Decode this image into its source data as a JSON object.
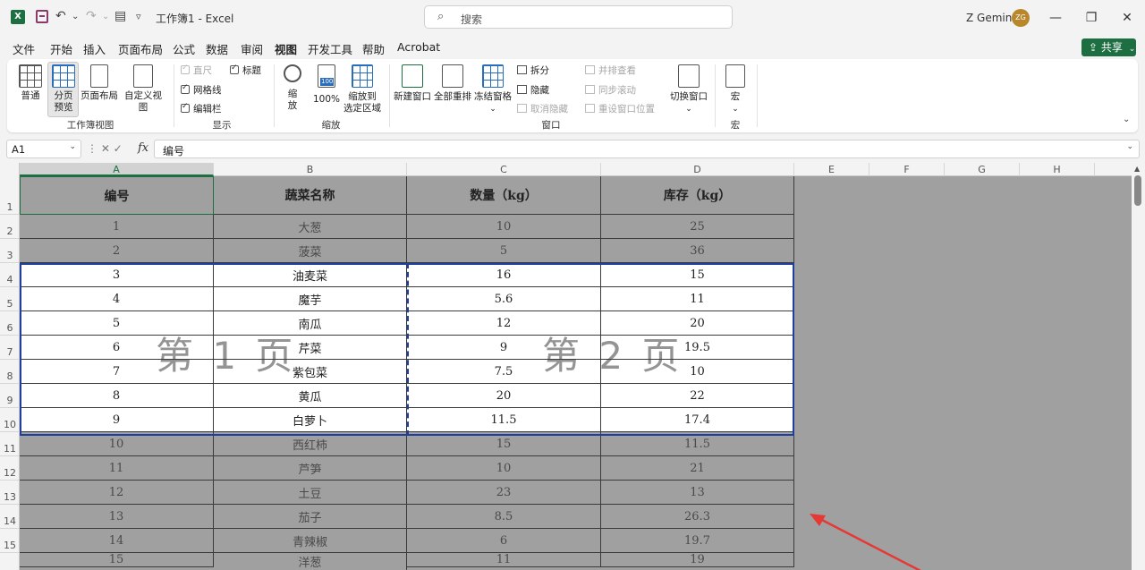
{
  "titlebar": {
    "logo": "X",
    "undo": "↶",
    "redo": "↷",
    "dropdown": "⌄",
    "form_icon": "▤",
    "customize": "▿",
    "title": "工作簿1 - Excel",
    "search_placeholder": "搜索",
    "search_icon": "⌕",
    "user_name": "Z Gemini",
    "avatar_initials": "ZG",
    "minimize": "—",
    "restore": "❐",
    "close": "✕"
  },
  "menu": {
    "items": [
      "文件",
      "开始",
      "插入",
      "页面布局",
      "公式",
      "数据",
      "审阅",
      "视图",
      "开发工具",
      "帮助",
      "Acrobat"
    ],
    "active": "视图",
    "share": "共享",
    "share_icon": "⇪"
  },
  "ribbon": {
    "workbook_views": {
      "label": "工作簿视图",
      "normal": "普通",
      "page_break_1": "分页",
      "page_break_2": "预览",
      "page_layout": "页面布局",
      "custom_views": "自定义视图"
    },
    "show": {
      "label": "显示",
      "ruler": "直尺",
      "gridlines": "网格线",
      "formula_bar": "编辑栏",
      "headings": "标题"
    },
    "zoom": {
      "label": "缩放",
      "zoom_1": "缩",
      "zoom_2": "放",
      "percent_100": "100%",
      "to_selection_1": "缩放到",
      "to_selection_2": "选定区域",
      "icon_100": "100"
    },
    "window": {
      "label": "窗口",
      "new_window": "新建窗口",
      "arrange_all": "全部重排",
      "freeze_panes": "冻结窗格",
      "split": "拆分",
      "hide": "隐藏",
      "unhide": "取消隐藏",
      "side_by_side": "并排查看",
      "sync_scroll": "同步滚动",
      "reset_position": "重设窗口位置",
      "switch_windows": "切换窗口",
      "caret": "⌄"
    },
    "macros": {
      "label": "宏",
      "macros": "宏",
      "caret": "⌄"
    },
    "collapse": "⌄"
  },
  "formula_bar": {
    "name_box": "A1",
    "name_dd": "⌄",
    "cancel_enter": "⋮  ✕  ✓",
    "fx": "fx",
    "content": "编号",
    "expand": "⌄"
  },
  "grid": {
    "columns": [
      "A",
      "B",
      "C",
      "D",
      "E",
      "F",
      "G",
      "H"
    ],
    "rows": [
      "1",
      "2",
      "3",
      "4",
      "5",
      "6",
      "7",
      "8",
      "9",
      "10",
      "11",
      "12",
      "13",
      "14",
      "15"
    ],
    "headers": [
      "编号",
      "蔬菜名称",
      "数量（kg）",
      "库存（kg）"
    ],
    "data": [
      [
        "1",
        "大葱",
        "10",
        "25"
      ],
      [
        "2",
        "菠菜",
        "5",
        "36"
      ],
      [
        "3",
        "油麦菜",
        "16",
        "15"
      ],
      [
        "4",
        "魔芋",
        "5.6",
        "11"
      ],
      [
        "5",
        "南瓜",
        "12",
        "20"
      ],
      [
        "6",
        "芹菜",
        "9",
        "19.5"
      ],
      [
        "7",
        "紫包菜",
        "7.5",
        "10"
      ],
      [
        "8",
        "黄瓜",
        "20",
        "22"
      ],
      [
        "9",
        "白萝卜",
        "11.5",
        "17.4"
      ],
      [
        "10",
        "西红柿",
        "15",
        "11.5"
      ],
      [
        "11",
        "芦笋",
        "10",
        "21"
      ],
      [
        "12",
        "土豆",
        "23",
        "13"
      ],
      [
        "13",
        "茄子",
        "8.5",
        "26.3"
      ],
      [
        "14",
        "青辣椒",
        "6",
        "19.7"
      ],
      [
        "15",
        "洋葱",
        "11",
        "19"
      ]
    ],
    "watermark_page1": "第 1 页",
    "watermark_page2": "第 2 页",
    "scroll_up": "▲"
  },
  "colors": {
    "accent": "#1d6f42",
    "page_border": "#1f3fa0",
    "annotation_arrow": "#e53935"
  }
}
